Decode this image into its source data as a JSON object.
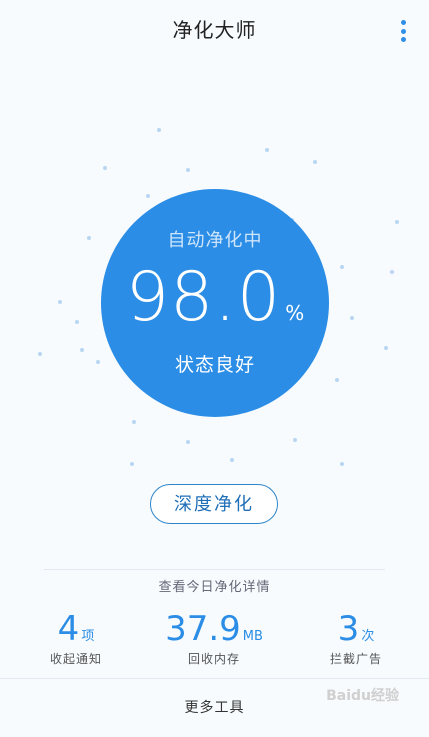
{
  "header": {
    "title": "净化大师",
    "more_icon": "more-vertical-icon"
  },
  "gauge": {
    "status_top": "自动净化中",
    "value": "98.0",
    "unit": "%",
    "status_bottom": "状态良好"
  },
  "deep_clean": {
    "label": "深度净化"
  },
  "details": {
    "link": "查看今日净化详情"
  },
  "stats": [
    {
      "value": "4",
      "unit": "项",
      "label": "收起通知"
    },
    {
      "value": "37.9",
      "unit": "MB",
      "label": "回收内存"
    },
    {
      "value": "3",
      "unit": "次",
      "label": "拦截广告"
    }
  ],
  "footer": {
    "more_tools": "更多工具"
  },
  "watermark": {
    "text": "Baidu经验"
  },
  "colors": {
    "accent": "#2b8de6",
    "background": "#f7fbfe"
  }
}
